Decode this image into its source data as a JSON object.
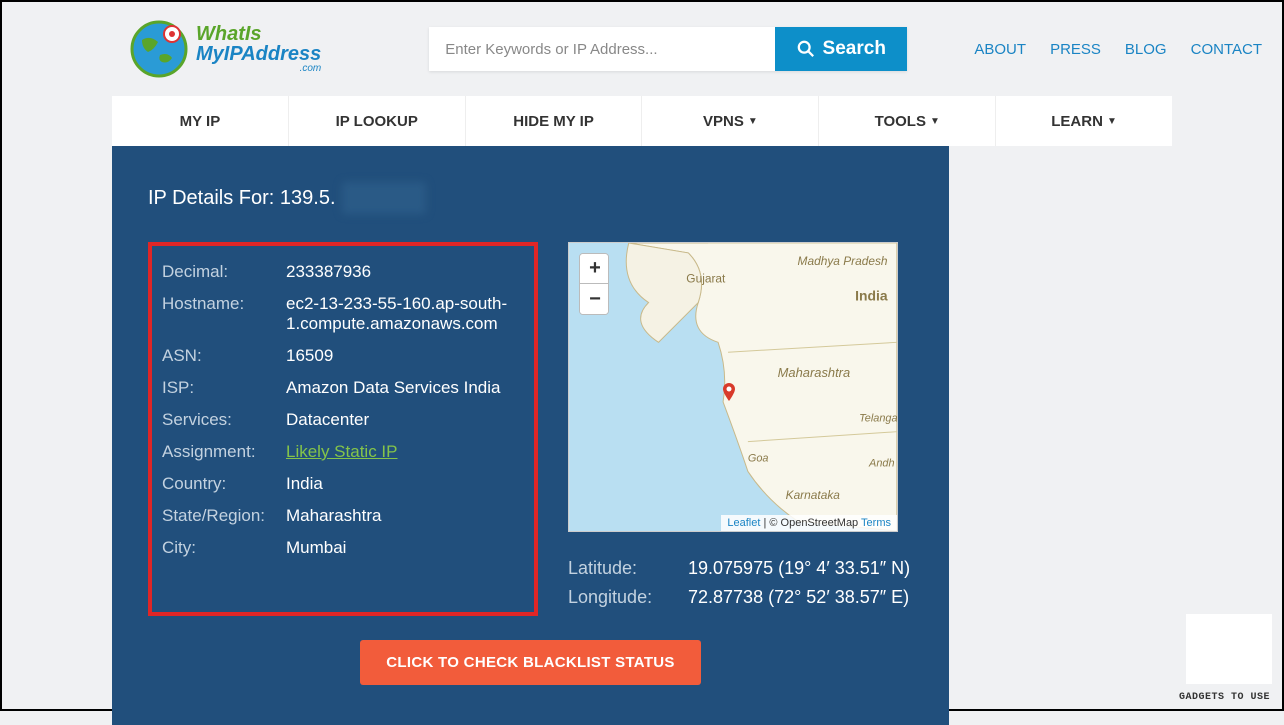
{
  "logo": {
    "line1": "WhatIs",
    "line2": "MyIPAddress",
    "sub": ".com"
  },
  "search": {
    "placeholder": "Enter Keywords or IP Address...",
    "button": "Search"
  },
  "topnav": [
    "ABOUT",
    "PRESS",
    "BLOG",
    "CONTACT"
  ],
  "mainnav": [
    {
      "label": "MY IP",
      "caret": false
    },
    {
      "label": "IP LOOKUP",
      "caret": false
    },
    {
      "label": "HIDE MY IP",
      "caret": false
    },
    {
      "label": "VPNS",
      "caret": true
    },
    {
      "label": "TOOLS",
      "caret": true
    },
    {
      "label": "LEARN",
      "caret": true
    }
  ],
  "heading": {
    "prefix": "IP Details For: 139.5."
  },
  "details": {
    "decimal_label": "Decimal:",
    "decimal": "233387936",
    "hostname_label": "Hostname:",
    "hostname": "ec2-13-233-55-160.ap-south-1.compute.amazonaws.com",
    "asn_label": "ASN:",
    "asn": "16509",
    "isp_label": "ISP:",
    "isp": "Amazon Data Services India",
    "services_label": "Services:",
    "services": "Datacenter",
    "assignment_label": "Assignment:",
    "assignment": "Likely Static IP",
    "country_label": "Country:",
    "country": "India",
    "region_label": "State/Region:",
    "region": "Maharashtra",
    "city_label": "City:",
    "city": "Mumbai"
  },
  "map": {
    "attribution_leaflet": "Leaflet",
    "attribution_sep": " | © OpenStreetMap ",
    "attribution_terms": "Terms",
    "labels": {
      "gujarat": "Gujarat",
      "madhya": "Madhya Pradesh",
      "india": "India",
      "maharashtra": "Maharashtra",
      "telangana": "Telanga",
      "goa": "Goa",
      "karnataka": "Karnataka",
      "andhra": "Andh"
    }
  },
  "coords": {
    "lat_label": "Latitude:",
    "lat": "19.075975  (19° 4′ 33.51″ N)",
    "lon_label": "Longitude:",
    "lon": "72.87738  (72° 52′ 38.57″ E)"
  },
  "blacklist_button": "CLICK TO CHECK BLACKLIST STATUS",
  "watermark": "GADGETS TO USE"
}
